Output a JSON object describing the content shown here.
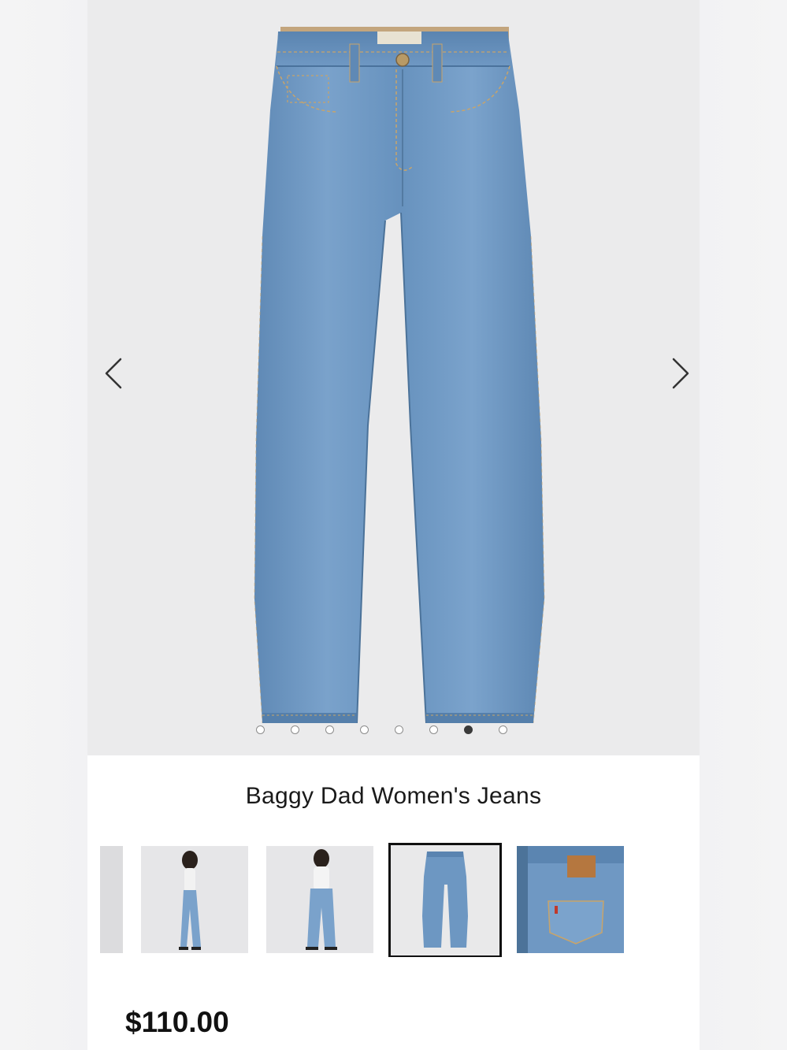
{
  "product": {
    "title": "Baggy Dad Women's Jeans",
    "price": "$110.00"
  },
  "gallery": {
    "current_index": 7,
    "slide_count": 8,
    "prev_icon": "chevron-left-icon",
    "next_icon": "chevron-right-icon"
  },
  "thumbnails": [
    {
      "name": "thumb-partial",
      "selected": false
    },
    {
      "name": "thumb-model-side",
      "selected": false
    },
    {
      "name": "thumb-model-front",
      "selected": false
    },
    {
      "name": "thumb-jeans-flat",
      "selected": true
    },
    {
      "name": "thumb-back-pocket",
      "selected": false
    }
  ],
  "colors": {
    "denim": "#6d97c2",
    "denim_dark": "#4f79a5",
    "background": "#ebebec",
    "selected_border": "#111111",
    "active_dot": "#3a3a3a"
  }
}
